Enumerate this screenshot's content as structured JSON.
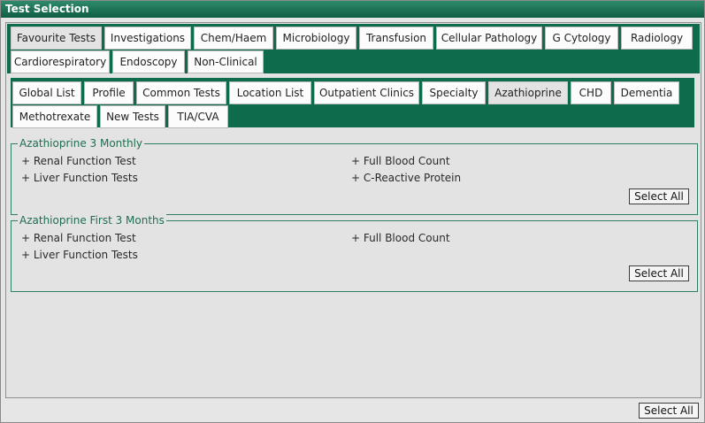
{
  "window": {
    "title": "Test Selection"
  },
  "top_tabs": [
    {
      "label": "Favourite Tests",
      "active": true
    },
    {
      "label": "Investigations"
    },
    {
      "label": "Chem/Haem"
    },
    {
      "label": "Microbiology"
    },
    {
      "label": "Transfusion"
    },
    {
      "label": "Cellular Pathology"
    },
    {
      "label": "G Cytology"
    },
    {
      "label": "Radiology"
    },
    {
      "label": "Cardiorespiratory"
    },
    {
      "label": "Endoscopy"
    },
    {
      "label": "Non-Clinical"
    }
  ],
  "sub_tabs": [
    {
      "label": "Global List"
    },
    {
      "label": "Profile"
    },
    {
      "label": "Common Tests"
    },
    {
      "label": "Location List"
    },
    {
      "label": "Outpatient Clinics"
    },
    {
      "label": "Specialty"
    },
    {
      "label": "Azathioprine",
      "active": true
    },
    {
      "label": "CHD"
    },
    {
      "label": "Dementia"
    },
    {
      "label": "Methotrexate"
    },
    {
      "label": "New Tests"
    },
    {
      "label": "TIA/CVA"
    }
  ],
  "groups": [
    {
      "title": "Azathioprine 3 Monthly",
      "tests": [
        "+ Renal Function Test",
        "+ Full Blood Count",
        "+ Liver Function Tests",
        "+ C-Reactive Protein"
      ],
      "select_all_label": "Select All"
    },
    {
      "title": "Azathioprine First 3 Months",
      "tests": [
        "+ Renal Function Test",
        "+ Full Blood Count",
        "+ Liver Function Tests"
      ],
      "select_all_label": "Select All"
    }
  ],
  "footer": {
    "select_all_label": "Select All"
  }
}
